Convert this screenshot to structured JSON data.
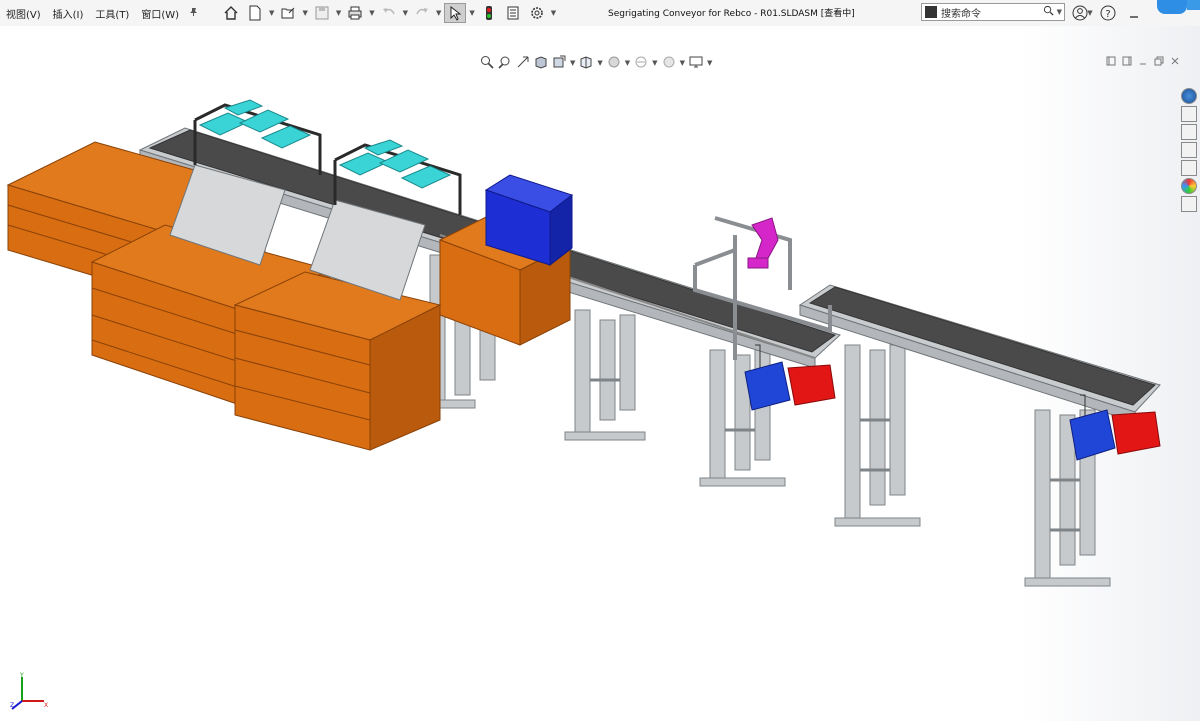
{
  "menu": {
    "items": [
      {
        "label": "视图(V)"
      },
      {
        "label": "插入(I)"
      },
      {
        "label": "工具(T)"
      },
      {
        "label": "窗口(W)"
      }
    ]
  },
  "toolbar": {
    "icons": [
      "pin-icon",
      "home-icon",
      "new-doc-icon",
      "open-icon",
      "save-icon",
      "print-icon",
      "undo-icon",
      "redo-icon",
      "select-arrow-icon",
      "traffic-light-icon",
      "file-props-icon",
      "options-gear-icon"
    ]
  },
  "document": {
    "title": "Segrigating Conveyor for Rebco - R01.SLDASM [查看中]"
  },
  "search": {
    "placeholder": "搜索命令"
  },
  "colors": {
    "crate": "#d86d12",
    "crate_dark": "#a4500a",
    "frame": "#c7cacd",
    "belt": "#4a4a4a",
    "blue_part": "#1d2fd4",
    "motor_red": "#e31616",
    "motor_blue": "#1f46d6",
    "cyan_part": "#3ad4d6",
    "magenta_part": "#d426c9",
    "chute": "#d6d8da"
  },
  "triad": {
    "x_label": "X",
    "y_label": "Y",
    "z_label": "Z"
  }
}
